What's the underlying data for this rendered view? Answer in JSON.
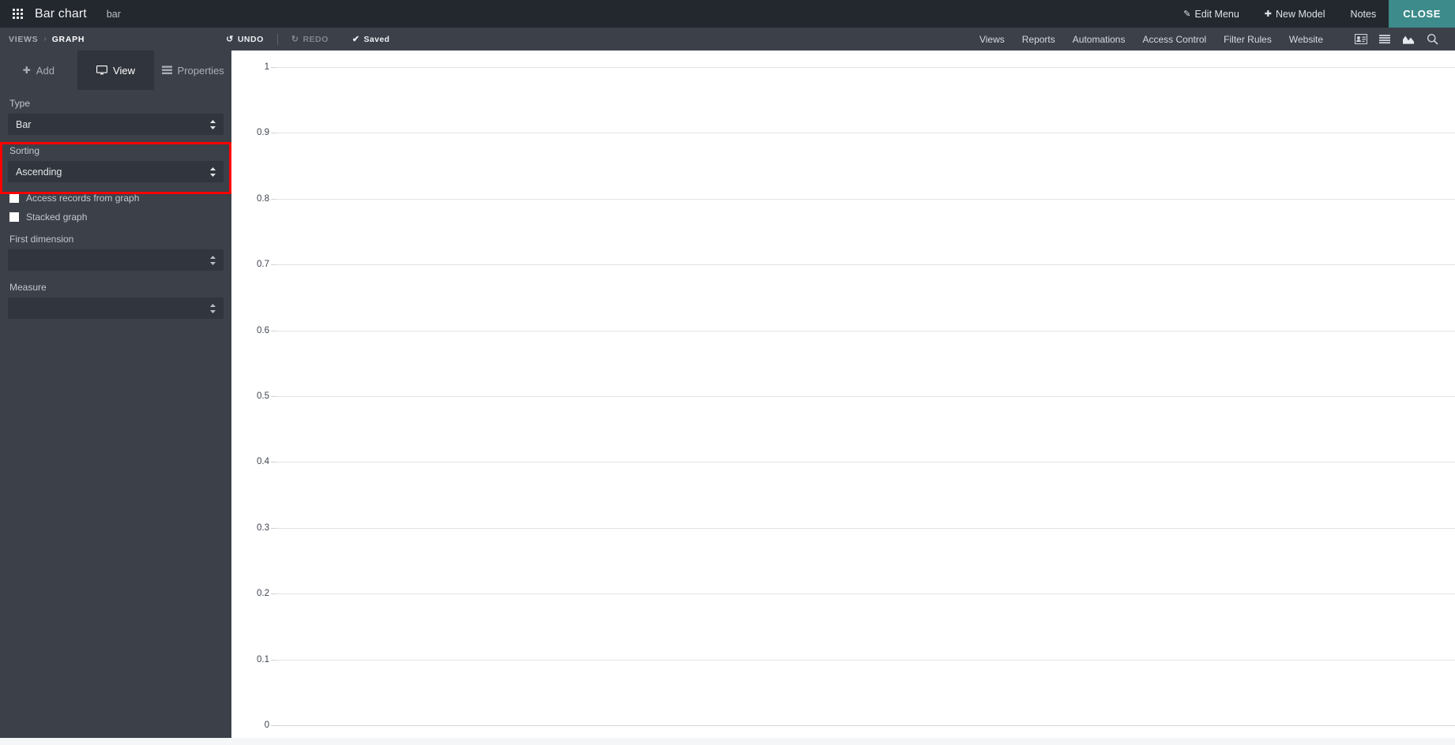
{
  "topbar": {
    "menu_icon": "grid-apps-icon",
    "title": "Bar chart",
    "subtitle": "bar",
    "edit_menu": "Edit Menu",
    "edit_menu_icon": "pencil-icon",
    "new_model": "New Model",
    "new_model_icon": "plus-icon",
    "notes": "Notes",
    "close": "CLOSE",
    "close_color": "#3d8b8b"
  },
  "subbar": {
    "breadcrumb": {
      "parent": "VIEWS",
      "separator": "›",
      "current": "GRAPH"
    },
    "undo": "UNDO",
    "undo_icon": "undo-arrow-icon",
    "redo": "REDO",
    "redo_icon": "redo-arrow-icon",
    "redo_disabled": true,
    "saved": "Saved",
    "saved_icon": "check-icon",
    "links": [
      "Views",
      "Reports",
      "Automations",
      "Access Control",
      "Filter Rules",
      "Website"
    ],
    "icons": [
      "contact-card-icon",
      "list-icon",
      "area-chart-icon",
      "search-icon"
    ]
  },
  "sidebar": {
    "tabs": [
      {
        "label": "Add",
        "icon": "plus-icon",
        "active": false
      },
      {
        "label": "View",
        "icon": "monitor-icon",
        "active": true
      },
      {
        "label": "Properties",
        "icon": "properties-list-icon",
        "active": false
      }
    ],
    "fields": [
      {
        "label": "Type",
        "value": "Bar",
        "highlighted": true
      },
      {
        "label": "Sorting",
        "value": "Ascending",
        "highlighted": false
      }
    ],
    "checkboxes": [
      {
        "label": "Access records from graph",
        "checked": false
      },
      {
        "label": "Stacked graph",
        "checked": false
      }
    ],
    "selects": [
      {
        "label": "First dimension",
        "value": ""
      },
      {
        "label": "Measure",
        "value": ""
      }
    ],
    "highlight_color": "#ff0000"
  },
  "chart_data": {
    "type": "bar",
    "title": "",
    "xlabel": "",
    "ylabel": "",
    "categories": [],
    "values": [],
    "series": [],
    "ylim": [
      0,
      1
    ],
    "yticks": [
      "0",
      "0.1",
      "0.2",
      "0.3",
      "0.4",
      "0.5",
      "0.6",
      "0.7",
      "0.8",
      "0.9",
      "1"
    ],
    "ytick_values": [
      0,
      0.1,
      0.2,
      0.3,
      0.4,
      0.5,
      0.6,
      0.7,
      0.8,
      0.9,
      1
    ],
    "xticks": [],
    "grid": true,
    "legend": false,
    "empty": true,
    "background": "#ffffff",
    "gridline_color": "#e2e3e5"
  }
}
